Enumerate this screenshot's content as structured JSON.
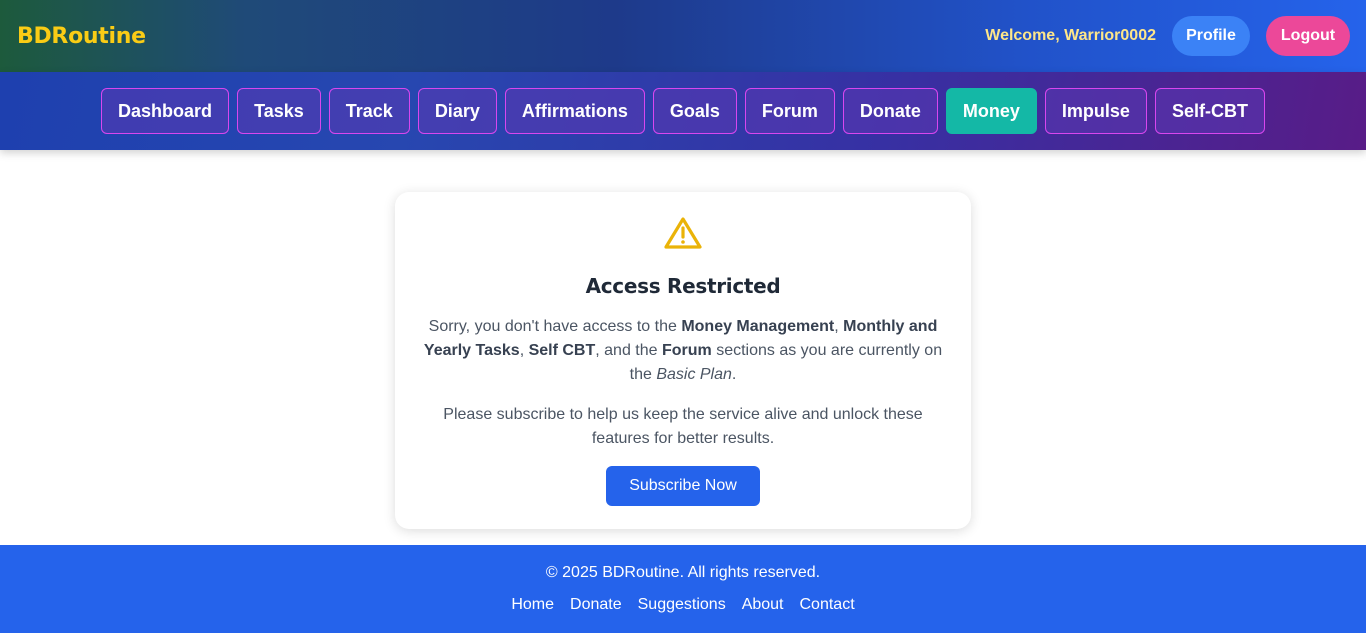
{
  "header": {
    "brand": "BDRoutine",
    "welcome": "Welcome, Warrior0002",
    "profile_label": "Profile",
    "logout_label": "Logout"
  },
  "nav": {
    "items": [
      {
        "label": "Dashboard"
      },
      {
        "label": "Tasks"
      },
      {
        "label": "Track"
      },
      {
        "label": "Diary"
      },
      {
        "label": "Affirmations"
      },
      {
        "label": "Goals"
      },
      {
        "label": "Forum"
      },
      {
        "label": "Donate"
      },
      {
        "label": "Money"
      },
      {
        "label": "Impulse"
      },
      {
        "label": "Self-CBT"
      }
    ],
    "active": "Money"
  },
  "card": {
    "icon": "warning-triangle-icon",
    "title": "Access Restricted",
    "msg_part1": "Sorry, you don't have access to the ",
    "msg_money": "Money Management",
    "msg_sep1": ", ",
    "msg_monthly": "Monthly and Yearly Tasks",
    "msg_sep2": ", ",
    "msg_cbt": "Self CBT",
    "msg_part2": ", and the ",
    "msg_forum": "Forum",
    "msg_part3": " sections as you are currently on the ",
    "msg_plan": "Basic Plan",
    "msg_end": ".",
    "msg2": "Please subscribe to help us keep the service alive and unlock these features for better results.",
    "subscribe_label": "Subscribe Now"
  },
  "footer": {
    "copyright": "© 2025 BDRoutine. All rights reserved.",
    "links": [
      "Home",
      "Donate",
      "Suggestions",
      "About",
      "Contact"
    ]
  },
  "colors": {
    "brand": "#facc15",
    "active_tab": "#14b8a6",
    "primary": "#2563eb",
    "logout": "#ec4899",
    "profile": "#3b82f6",
    "warning": "#eab308"
  }
}
